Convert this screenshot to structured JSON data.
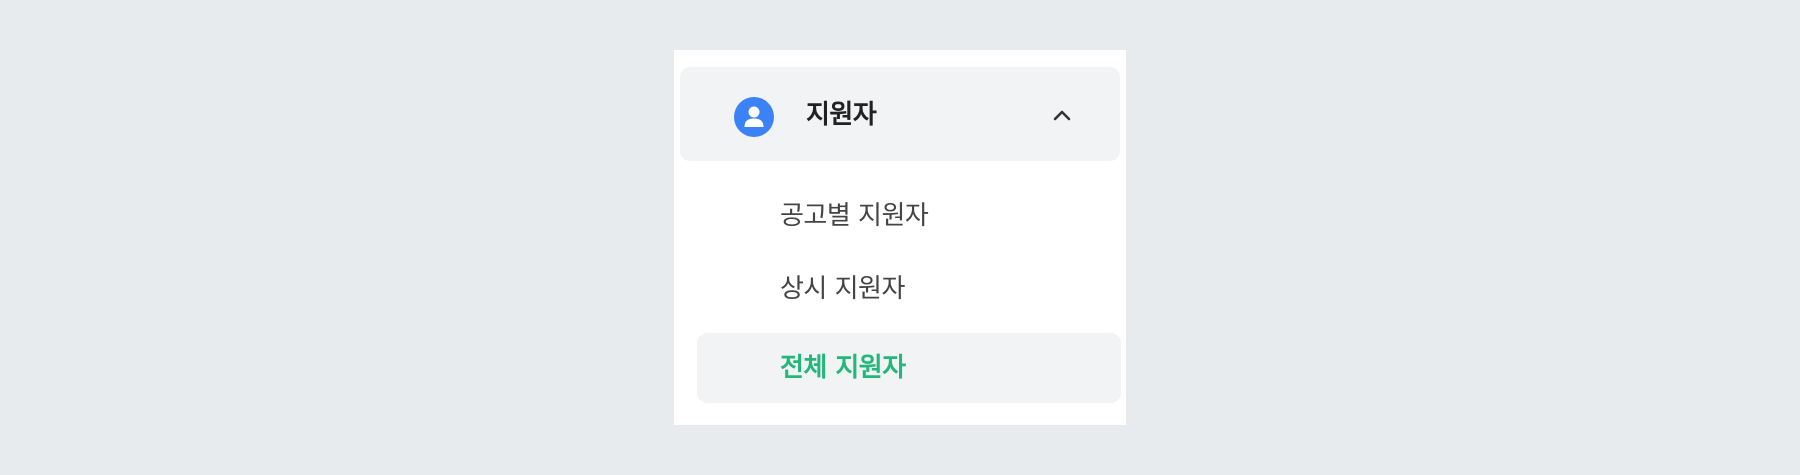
{
  "colors": {
    "page_background": "#e8ebee",
    "panel_background": "#ffffff",
    "header_background": "#f2f3f5",
    "icon_blue": "#3b82f6",
    "active_green": "#23b87a"
  },
  "menu": {
    "group": {
      "title": "지원자",
      "icon": "user-icon",
      "expanded": true,
      "toggle_icon": "chevron-up-icon"
    },
    "items": [
      {
        "label": "공고별 지원자",
        "active": false
      },
      {
        "label": "상시 지원자",
        "active": false
      },
      {
        "label": "전체 지원자",
        "active": true
      }
    ]
  }
}
